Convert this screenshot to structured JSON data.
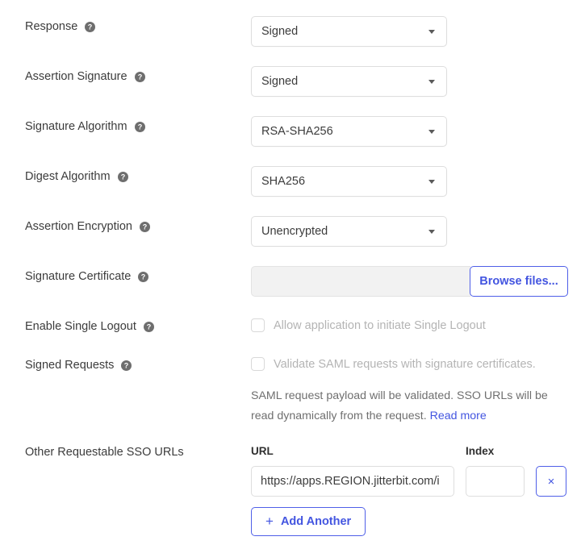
{
  "form": {
    "rows": [
      {
        "label": "Response",
        "help_icon": "help-circle-icon",
        "control": "select",
        "value": "Signed"
      },
      {
        "label": "Assertion Signature",
        "help_icon": "help-circle-icon",
        "control": "select",
        "value": "Signed"
      },
      {
        "label": "Signature Algorithm",
        "help_icon": "help-circle-icon",
        "control": "select",
        "value": "RSA-SHA256"
      },
      {
        "label": "Digest Algorithm",
        "help_icon": "help-circle-icon",
        "control": "select",
        "value": "SHA256"
      },
      {
        "label": "Assertion Encryption",
        "help_icon": "help-circle-icon",
        "control": "select",
        "value": "Unencrypted"
      },
      {
        "label": "Signature Certificate",
        "help_icon": "help-circle-icon",
        "control": "file"
      },
      {
        "label": "Enable Single Logout",
        "help_icon": "help-circle-icon",
        "control": "checkbox"
      },
      {
        "label": "Signed Requests",
        "help_icon": "help-circle-icon",
        "control": "checkbox"
      },
      {
        "label": "Other Requestable SSO URLs",
        "help_icon": null,
        "control": "url-table"
      }
    ],
    "file_picker": {
      "file_value": "",
      "browse_label": "Browse files..."
    },
    "single_logout": {
      "checkbox_label": "Allow application to initiate Single Logout",
      "checked": false
    },
    "signed_requests": {
      "checkbox_label": "Validate SAML requests with signature certificates.",
      "checked": false,
      "helper_text": "SAML request payload will be validated. SSO URLs will be read dynamically from the request.",
      "helper_link": "Read more"
    },
    "sso_urls": {
      "url_header": "URL",
      "index_header": "Index",
      "url_value": "https://apps.REGION.jitterbit.com/i",
      "url_placeholder": "",
      "index_value": "",
      "index_placeholder": "",
      "remove_label": "×",
      "add_label": "Add Another",
      "add_plus": "+"
    }
  },
  "colors": {
    "accent_blue": "#4355e0",
    "accent_blue_border": "#4f5fe8",
    "label_text": "#3c3c3c",
    "disabled_text": "#b4b4b4",
    "helper_text": "#6f6f6f",
    "field_border": "#dedede",
    "disabled_field_bg": "#f2f2f2",
    "help_icon_bg": "#6e6e6e"
  }
}
